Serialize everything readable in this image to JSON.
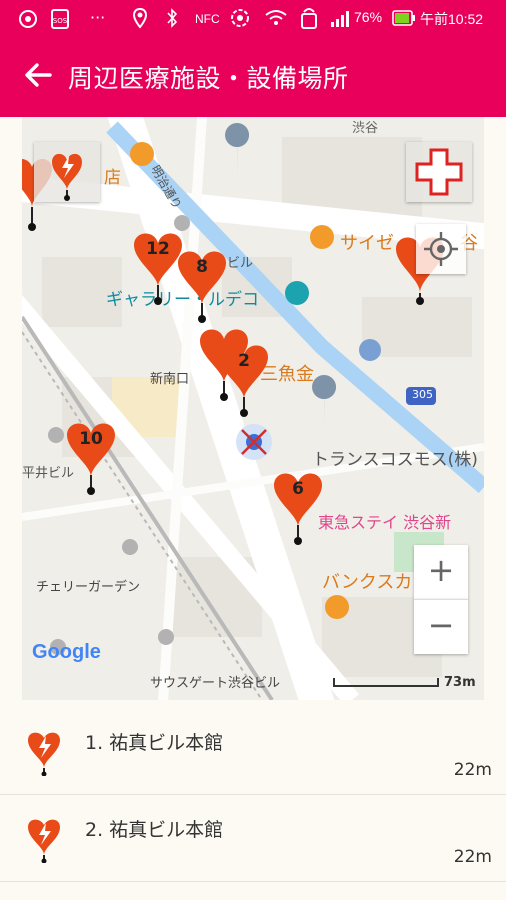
{
  "statusbar": {
    "battery": "76%",
    "time": "午前10:52",
    "nfc": "NFC"
  },
  "appbar": {
    "title": "周辺医療施設・設備場所"
  },
  "map": {
    "labels": {
      "station_top": "渋谷",
      "shop_ten": "店",
      "meiji_dori": "明治通り",
      "bill": "ビル",
      "saize": "サイゼ",
      "shibuya": "谷",
      "gallery": "ギャラリー・ルデコ",
      "sanuokin": "三魚金",
      "shinminamiguchi": "新南口",
      "trans": "トランスコスモス(株)",
      "route": "305",
      "tokyu": "東急ステイ 渋谷新",
      "bancs": "バンクスカ",
      "cherry": "チェリーガーデン",
      "southgate": "サウスゲート渋谷ビル",
      "hirai": "平井ビル",
      "google": "Google",
      "scale": "73m"
    },
    "markers": [
      "12",
      "8",
      "2",
      "10",
      "6"
    ],
    "zoom_in": "+",
    "zoom_out": "−"
  },
  "list": [
    {
      "name": "1. 祐真ビル本館",
      "distance": "22m"
    },
    {
      "name": "2. 祐真ビル本館",
      "distance": "22m"
    }
  ]
}
